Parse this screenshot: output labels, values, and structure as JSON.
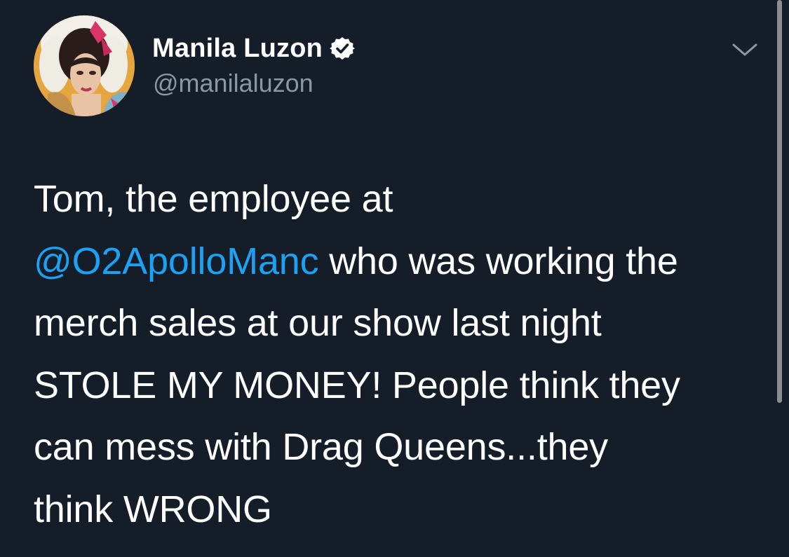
{
  "author": {
    "display_name": "Manila Luzon",
    "handle": "@manilaluzon",
    "verified": true
  },
  "tweet": {
    "line1": "Tom, the employee at",
    "mention": "@O2ApolloManc",
    "line2_rest": " who was working the",
    "line3": "merch sales at our show last night",
    "line4": "STOLE MY MONEY! People think they",
    "line5": "can mess with Drag Queens...they",
    "line6": "think WRONG"
  },
  "icons": {
    "verified": "verified-badge-icon",
    "more": "chevron-down-icon"
  },
  "colors": {
    "background": "#151d29",
    "text": "#ffffff",
    "handle": "#8899a6",
    "mention": "#1da1f2"
  }
}
